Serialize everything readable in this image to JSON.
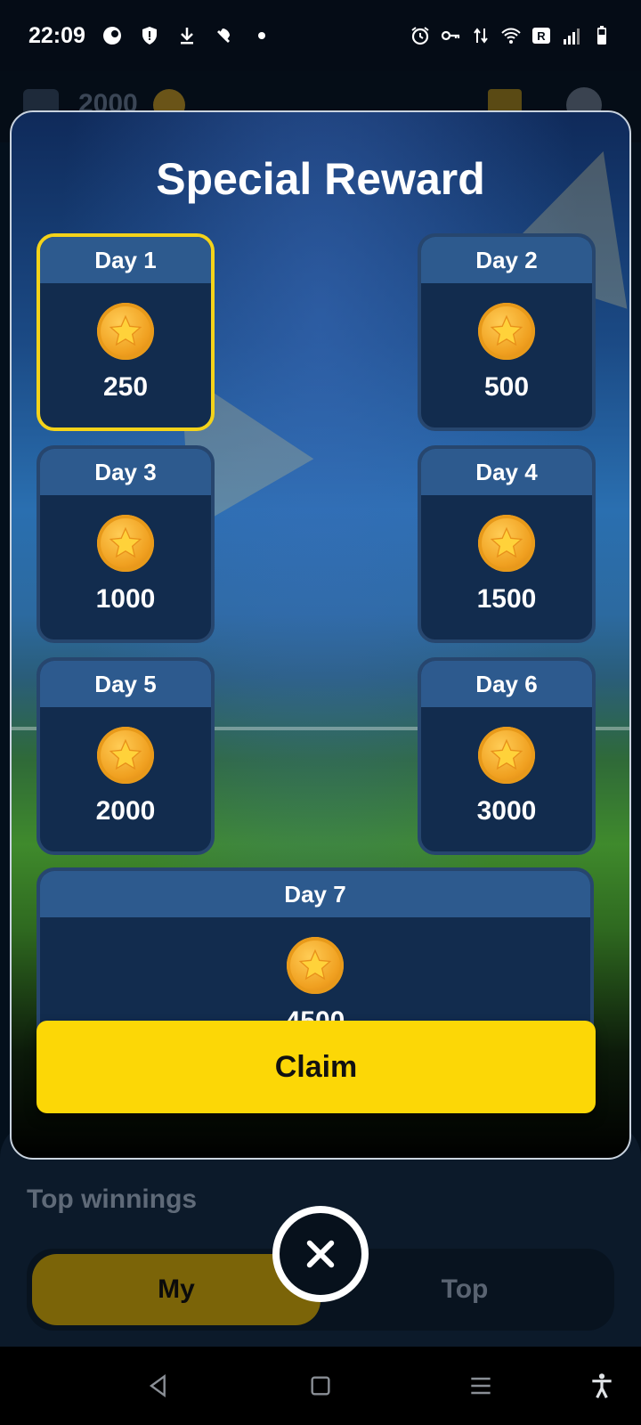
{
  "status_bar": {
    "time": "22:09",
    "left_icons": [
      "app-icon",
      "shield-icon",
      "download-icon",
      "mute-icon",
      "dot-icon"
    ],
    "right_icons": [
      "alarm-icon",
      "vpn-key-icon",
      "data-arrows-icon",
      "wifi-icon",
      "roaming-icon",
      "signal-icon",
      "battery-icon"
    ]
  },
  "app_header": {
    "coins": "2000",
    "icons": [
      "wallet-icon",
      "coin-icon",
      "gift-icon",
      "gear-icon"
    ]
  },
  "modal": {
    "title": "Special Reward",
    "days": [
      {
        "label": "Day 1",
        "amount": "250",
        "selected": true
      },
      {
        "label": "Day 2",
        "amount": "500",
        "selected": false
      },
      {
        "label": "Day 3",
        "amount": "1000",
        "selected": false
      },
      {
        "label": "Day 4",
        "amount": "1500",
        "selected": false
      },
      {
        "label": "Day 5",
        "amount": "2000",
        "selected": false
      },
      {
        "label": "Day 6",
        "amount": "3000",
        "selected": false
      },
      {
        "label": "Day 7",
        "amount": "4500",
        "selected": false
      }
    ],
    "claim_label": "Claim"
  },
  "background_page": {
    "section_title": "Top winnings",
    "tabs": [
      {
        "label": "My",
        "active": true
      },
      {
        "label": "Top",
        "active": false
      }
    ]
  },
  "colors": {
    "accent_yellow": "#fcd706",
    "selected_border": "#f4d31a",
    "card_header": "#2d5a8e",
    "card_body": "#122c4e"
  }
}
